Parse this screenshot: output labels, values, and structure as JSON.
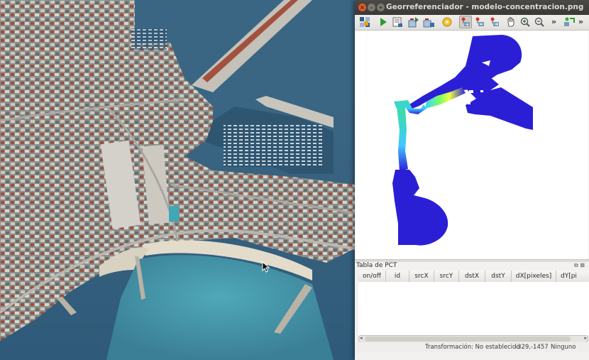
{
  "window": {
    "title": "Georreferenciador - modelo-concentracion.png"
  },
  "toolbar": {
    "icons": [
      "open-raster-icon",
      "start-georef-icon",
      "generate-script-icon",
      "load-points-icon",
      "save-points-icon",
      "settings-icon",
      "add-point-icon",
      "delete-point-icon",
      "move-point-icon",
      "pan-icon",
      "zoom-in-icon",
      "zoom-out-icon",
      "link-icon"
    ],
    "overflow_1": "»",
    "overflow_2": "»"
  },
  "gcp_panel": {
    "title": "Tabla de PCT",
    "columns": [
      "on/off",
      "id",
      "srcX",
      "srcY",
      "dstX",
      "dstY",
      "dX[pixeles]",
      "dY[pi"
    ]
  },
  "status": {
    "transform": "Transformación: No establecido",
    "coords": "-329,-1457",
    "crs": "Ninguno"
  },
  "colors": {
    "title_bar": "#3c3b37",
    "close_button": "#e05a2b",
    "model_blue": "#2b1fd6"
  }
}
